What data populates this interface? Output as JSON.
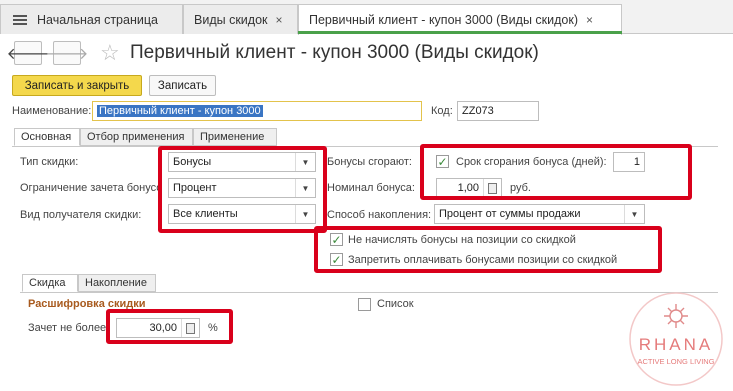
{
  "tabs": {
    "home": "Начальная страница",
    "discounts": "Виды скидок",
    "current": "Первичный клиент - купон 3000 (Виды скидок)",
    "close": "×"
  },
  "header": {
    "back": "🡐",
    "forward": "🡒",
    "star": "☆",
    "title": "Первичный клиент - купон 3000 (Виды скидок)"
  },
  "toolbar": {
    "save_close": "Записать и закрыть",
    "save": "Записать"
  },
  "form": {
    "name_label": "Наименование:",
    "name_value": "Первичный клиент - купон 3000",
    "code_label": "Код:",
    "code_value": "ZZ073"
  },
  "section_tabs": [
    "Основная",
    "Отбор применения",
    "Применение"
  ],
  "main": {
    "discount_type_label": "Тип скидки:",
    "discount_type_value": "Бонусы",
    "bonus_limit_label": "Ограничение зачета бонусов:",
    "bonus_limit_value": "Процент",
    "recipient_label": "Вид получателя скидки:",
    "recipient_value": "Все клиенты",
    "bonus_expire_label": "Бонусы сгорают:",
    "expire_period_label": "Срок сгорания бонуса (дней):",
    "expire_period_value": "1",
    "nominal_label": "Номинал бонуса:",
    "nominal_value": "1,00",
    "nominal_unit": "руб.",
    "accrual_label": "Способ накопления:",
    "accrual_value": "Процент от суммы продажи",
    "no_accrue_discounted": "Не начислять бонусы на позиции со скидкой",
    "forbid_pay_discounted": "Запретить оплачивать бонусами позиции со скидкой",
    "checkmark": "✓"
  },
  "sub_tabs": [
    "Скидка",
    "Накопление"
  ],
  "sub": {
    "section_title": "Расшифровка скидки",
    "list_label": "Список",
    "credit_label": "Зачет не более:",
    "credit_value": "30,00",
    "credit_unit": "%"
  },
  "watermark": {
    "brand": "RHANA",
    "tagline": "ACTIVE LONG LIVING"
  },
  "colors": {
    "highlight": "#d9001b",
    "accent": "#f4d84c",
    "active_tab_line": "#4aa14a"
  }
}
